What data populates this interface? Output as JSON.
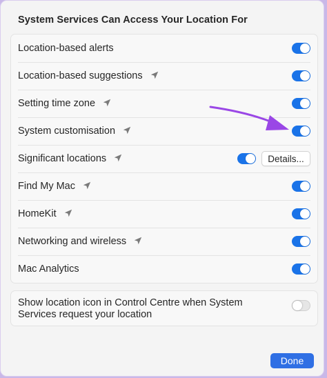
{
  "section_title": "System Services Can Access Your Location For",
  "rows": [
    {
      "label": "Location-based alerts",
      "arrow": false,
      "toggle": "on"
    },
    {
      "label": "Location-based suggestions",
      "arrow": true,
      "toggle": "on"
    },
    {
      "label": "Setting time zone",
      "arrow": true,
      "toggle": "on"
    },
    {
      "label": "System customisation",
      "arrow": true,
      "toggle": "on"
    },
    {
      "label": "Significant locations",
      "arrow": true,
      "toggle": "on",
      "button": "Details..."
    },
    {
      "label": "Find My Mac",
      "arrow": true,
      "toggle": "on"
    },
    {
      "label": "HomeKit",
      "arrow": true,
      "toggle": "on"
    },
    {
      "label": "Networking and wireless",
      "arrow": true,
      "toggle": "on"
    },
    {
      "label": "Mac Analytics",
      "arrow": false,
      "toggle": "on"
    }
  ],
  "icons": {
    "location_arrow": "location-arrow-icon",
    "callout_arrow": "annotation-arrow"
  },
  "footer_option": {
    "label": "Show location icon in Control Centre when System Services request your location",
    "toggle": "off"
  },
  "done_label": "Done",
  "colors": {
    "accent": "#2f6fe4",
    "toggle_on": "#1f6fe5",
    "annotation": "#9a47e6"
  }
}
